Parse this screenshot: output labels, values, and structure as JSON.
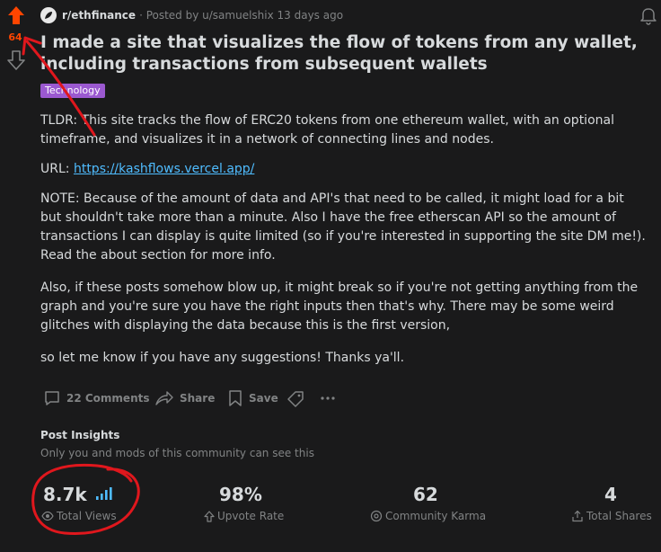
{
  "post": {
    "score": "64",
    "subreddit": "r/ethfinance",
    "posted_by": "· Posted by u/samuelshix 13 days ago",
    "title": "I made a site that visualizes the flow of tokens from any wallet, including transactions from subsequent wallets",
    "flair": "Technology",
    "body": {
      "p1": "TLDR: This site tracks the flow of ERC20 tokens from one ethereum wallet, with an optional timeframe, and visualizes it in a network of connecting lines and nodes.",
      "url_label": "URL: ",
      "url_text": "https://kashflows.vercel.app/",
      "p3": "NOTE: Because of the amount of data and API's that need to be called, it might load for a bit but shouldn't take more than a minute. Also I have the free etherscan API so the amount of transactions I can display is quite limited (so if you're interested in supporting the site DM me!). Read the about section for more info.",
      "p4": "Also, if these posts somehow blow up, it might break so if you're not getting anything from the graph and you're sure you have the right inputs then that's why. There may be some weird glitches with displaying the data because this is the first version,",
      "p5": "so let me know if you have any suggestions! Thanks ya'll."
    }
  },
  "actions": {
    "comments": "22 Comments",
    "share": "Share",
    "save": "Save"
  },
  "insights": {
    "title": "Post Insights",
    "subtitle": "Only you and mods of this community can see this",
    "stats": [
      {
        "value": "8.7k",
        "label": "Total Views"
      },
      {
        "value": "98%",
        "label": "Upvote Rate"
      },
      {
        "value": "62",
        "label": "Community Karma"
      },
      {
        "value": "4",
        "label": "Total Shares"
      }
    ]
  },
  "colors": {
    "background": "#1a1a1b",
    "upvote_active": "#ff4500",
    "flair": "#9b59d0",
    "link": "#4fbcff",
    "annotation": "#e0171d"
  },
  "icons": [
    "upvote-icon",
    "downvote-icon",
    "subreddit-icon",
    "bell-icon",
    "comment-icon",
    "share-icon",
    "save-icon",
    "tag-icon",
    "more-icon",
    "bar-chart-icon",
    "eye-icon",
    "upvote-outline-icon",
    "karma-icon",
    "share-up-icon"
  ]
}
